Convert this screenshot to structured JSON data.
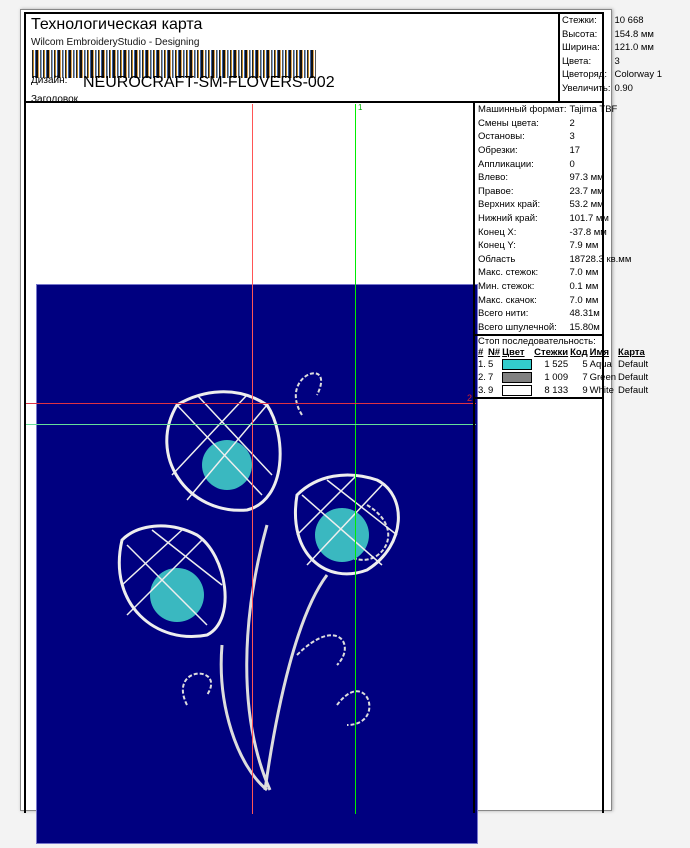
{
  "header": {
    "title": "Технологическая карта",
    "subtitle": "Wilcom EmbroideryStudio - Designing",
    "design_label": "Дизайн:",
    "design_name": "NEUROCRAFT-SM-FLOVERS-002",
    "heading_label": "Заголовок"
  },
  "summary": [
    {
      "k": "Стежки:",
      "v": "10 668"
    },
    {
      "k": "Высота:",
      "v": "154.8 мм"
    },
    {
      "k": "Ширина:",
      "v": "121.0 мм"
    },
    {
      "k": "Цвета:",
      "v": "3"
    },
    {
      "k": "Цветоряд:",
      "v": "Colorway 1"
    },
    {
      "k": "Увеличить:",
      "v": "0.90"
    }
  ],
  "details": [
    {
      "k": "Машинный формат:",
      "v": "Tajima TBF"
    },
    {
      "k": "Смены цвета:",
      "v": "2"
    },
    {
      "k": "Остановы:",
      "v": "3"
    },
    {
      "k": "Обрезки:",
      "v": "17"
    },
    {
      "k": "Аппликации:",
      "v": "0"
    },
    {
      "k": "Влево:",
      "v": "97.3 мм"
    },
    {
      "k": "Правое:",
      "v": "23.7 мм"
    },
    {
      "k": "Верхних край:",
      "v": "53.2 мм"
    },
    {
      "k": "Нижний край:",
      "v": "101.7 мм"
    },
    {
      "k": "Конец X:",
      "v": "-37.8 мм"
    },
    {
      "k": "Конец Y:",
      "v": "7.9 мм"
    },
    {
      "k": "Область",
      "v": "18728.3 кв.мм"
    },
    {
      "k": "Макс. стежок:",
      "v": "7.0 мм"
    },
    {
      "k": "Мин. стежок:",
      "v": "0.1 мм"
    },
    {
      "k": "Макс. скачок:",
      "v": "7.0 мм"
    },
    {
      "k": "Всего нити:",
      "v": "48.31м"
    },
    {
      "k": "Всего шпулечной:",
      "v": "15.80м"
    }
  ],
  "stop_sequence": {
    "title": "Стоп последовательность:",
    "columns": [
      "#",
      "N#",
      "Цвет",
      "Стежки",
      "Код",
      "Имя",
      "Карта"
    ],
    "rows": [
      {
        "idx": "1.",
        "n": "5",
        "color": "#33cccc",
        "stitches": "1 525",
        "code": "5",
        "name": "Aqua",
        "chart": "Default"
      },
      {
        "idx": "2.",
        "n": "7",
        "color": "#808080",
        "stitches": "1 009",
        "code": "7",
        "name": "Green",
        "chart": "Default"
      },
      {
        "idx": "3.",
        "n": "9",
        "color": "#ffffff",
        "stitches": "8 133",
        "code": "9",
        "name": "White",
        "chart": "Default"
      }
    ]
  },
  "guides": {
    "green_label": "1",
    "red_label": "2"
  },
  "colors": {
    "background": "#000080",
    "red_guide": "#ff5555",
    "green_guide": "#00ee00"
  }
}
